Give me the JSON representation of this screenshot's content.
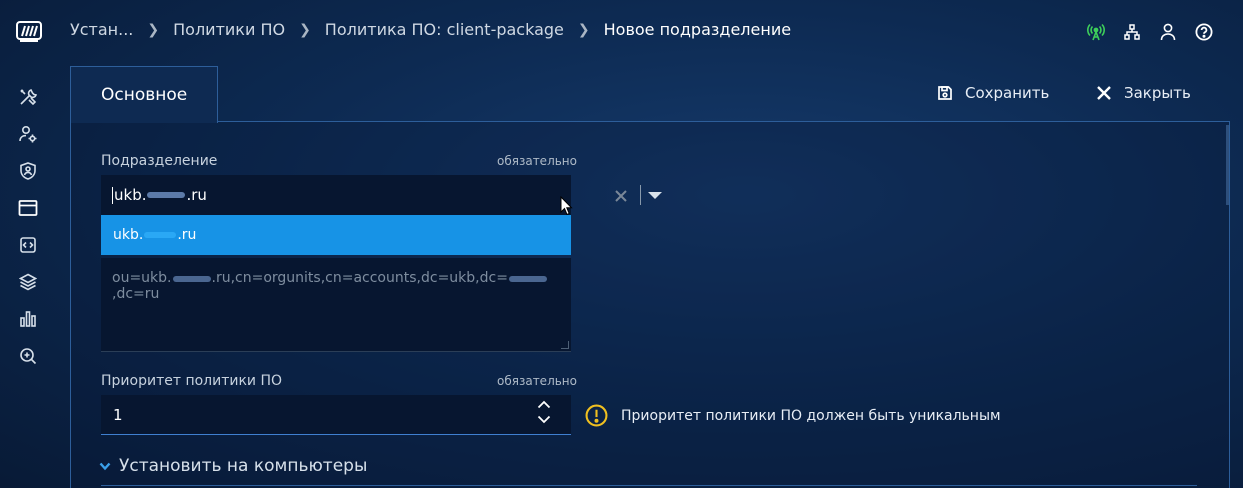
{
  "breadcrumb": {
    "items": [
      "Устан...",
      "Политики ПО",
      "Политика ПО: client-package"
    ],
    "current": "Новое подразделение"
  },
  "topbar_icons": [
    "network-status-icon",
    "hierarchy-icon",
    "user-icon",
    "help-icon"
  ],
  "sidebar": {
    "items": [
      "tools-icon",
      "user-settings-icon",
      "user-shield-icon",
      "card-icon",
      "code-icon",
      "layers-icon",
      "bar-chart-icon",
      "search-icon"
    ],
    "active": "card-icon"
  },
  "tabs": [
    {
      "label": "Основное"
    }
  ],
  "toolbar": {
    "save_label": "Сохранить",
    "close_label": "Закрыть"
  },
  "form": {
    "department": {
      "label": "Подразделение",
      "required": "обязательно",
      "value_prefix": "ukb.",
      "value_suffix": ".ru",
      "option_prefix": "ukb.",
      "option_suffix": ".ru"
    },
    "dn": {
      "part1": "ou=ukb.",
      "part2": ".ru,cn=orgunits,cn=accounts,dc=ukb,dc=",
      "part3": ",dc=ru"
    },
    "priority": {
      "label": "Приоритет политики ПО",
      "required": "обязательно",
      "value": "1",
      "warning": "Приоритет политики ПО должен быть уникальным"
    },
    "install_section": {
      "label": "Установить на компьютеры"
    }
  },
  "colors": {
    "accent": "#1793e6",
    "warning": "#f0c020",
    "network": "#3ecf5a"
  }
}
